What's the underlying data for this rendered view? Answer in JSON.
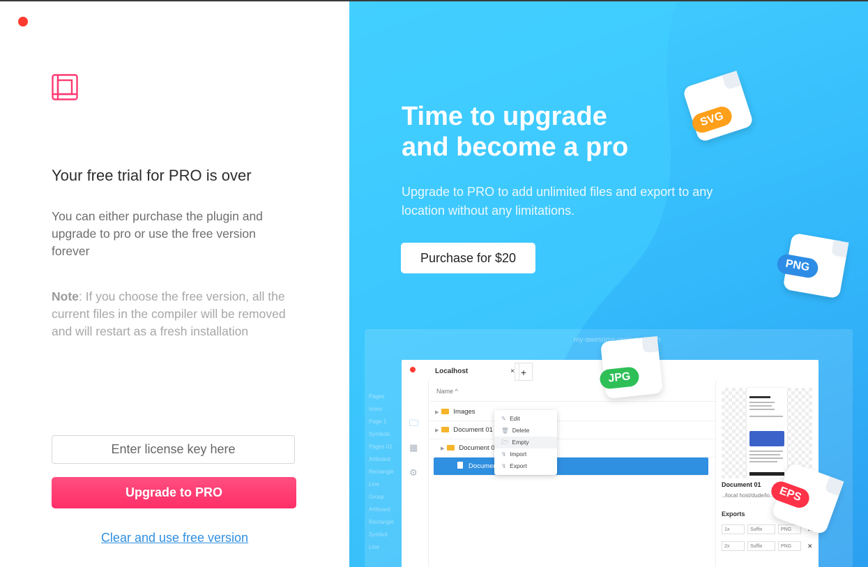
{
  "left": {
    "title": "Your free trial for PRO is over",
    "description": "You can either purchase the plugin and upgrade to pro or use the free version forever",
    "note_label": "Note",
    "note_text": ": If you choose the free version, all the current files in the compiler will be removed and will restart as a fresh installation",
    "license_placeholder": "Enter license key here",
    "upgrade_label": "Upgrade to PRO",
    "free_link": "Clear and use free version"
  },
  "right": {
    "title_line1": "Time to upgrade",
    "title_line2": "and become a pro",
    "subtitle": "Upgrade to PRO to add unlimited files and export to any location without any limitations.",
    "purchase_label": "Purchase for $20",
    "badges": {
      "svg": "SVG",
      "png": "PNG",
      "jpg": "JPG",
      "eps": "EPS"
    }
  },
  "mock": {
    "ghost_title": "my-awesome-project.sketch",
    "ghost_side": [
      "Pages",
      "Icons",
      "Page 1",
      "Symbols",
      "Pages 01",
      "Artboard",
      "Rectangle",
      "Line",
      "Group",
      "Artboard",
      "Rectangle",
      "Symbol",
      "Line"
    ],
    "tab": "Localhost",
    "tab_close": "×",
    "plus": "+",
    "column": "Name ^",
    "rows": [
      "Images",
      "Document 01",
      "Document 01",
      "Document"
    ],
    "menu": [
      "Edit",
      "Delete",
      "Empty",
      "Import",
      "Export"
    ],
    "doc_name": "Document 01",
    "doc_path": "../local host/dude/lo...",
    "exports_label": "Exports",
    "export_rows": [
      {
        "scale": "1x",
        "suffix": "Suffix",
        "format": "PNG"
      },
      {
        "scale": "2x",
        "suffix": "Suffix",
        "format": "PNG"
      }
    ]
  },
  "colors": {
    "accent_pink": "#ff3a72",
    "link_blue": "#2f8fe0",
    "panel_blue": "#33b8fb",
    "svg_badge": "#ff9f1a",
    "png_badge": "#2d8de6",
    "jpg_badge": "#2fbf57",
    "eps_badge": "#ff3247"
  }
}
